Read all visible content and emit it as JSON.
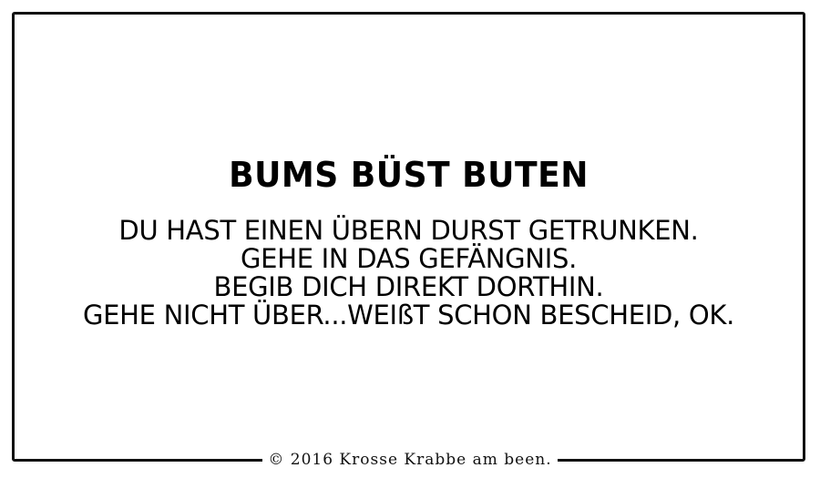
{
  "card": {
    "title": "BUMS BÜST BUTEN",
    "lines": [
      "DU HAST EINEN ÜBERN DURST GETRUNKEN.",
      "GEHE IN DAS GEFÄNGNIS.",
      "BEGIB DICH DIREKT DORTHIN.",
      "GEHE NICHT ÜBER...WEIßT SCHON BESCHEID, OK."
    ]
  },
  "footer": {
    "copyright": "© 2016 Krosse Krabbe am been."
  },
  "colors": {
    "border": "#111111",
    "text": "#000000",
    "background": "#ffffff"
  }
}
